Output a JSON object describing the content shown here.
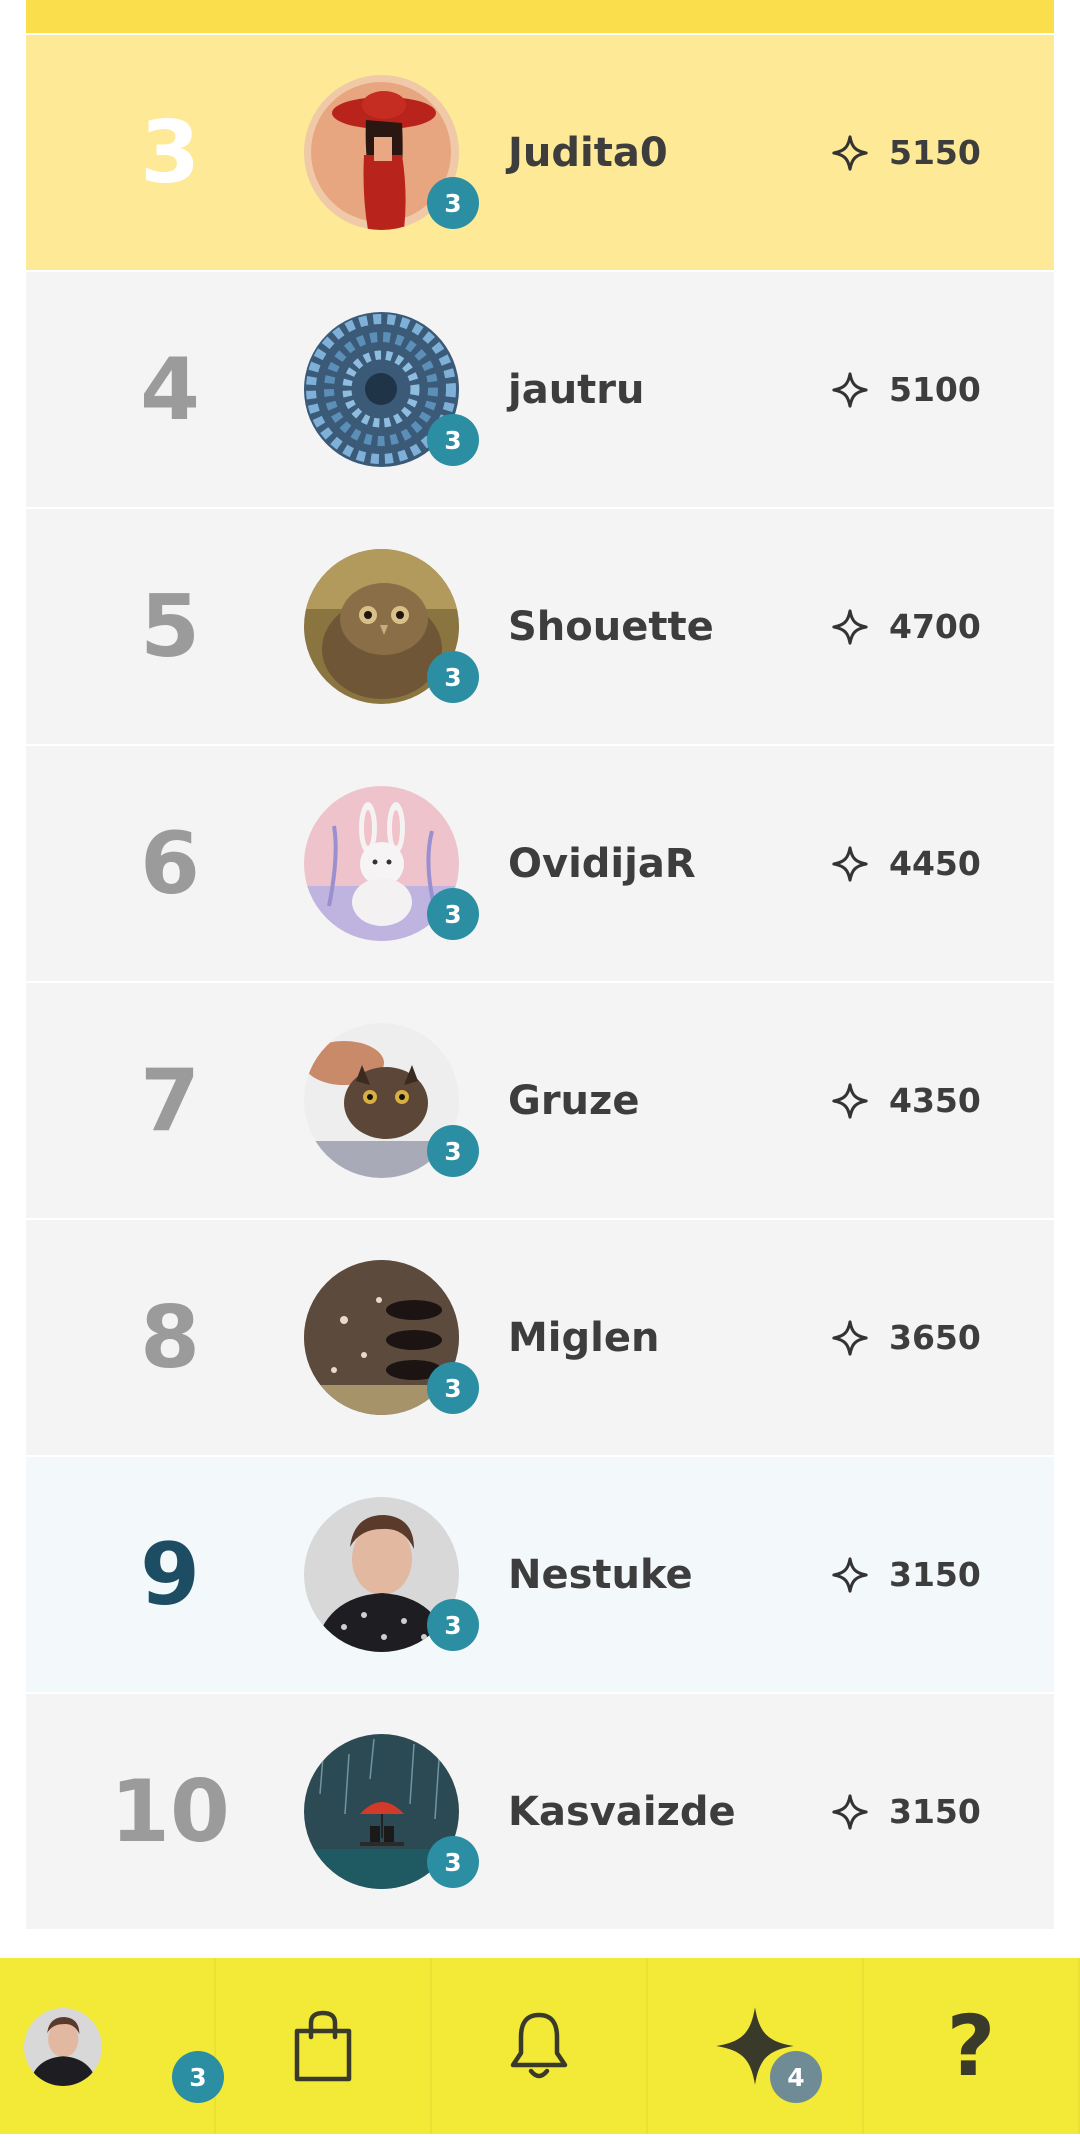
{
  "leaderboard": {
    "rows": [
      {
        "rank": "3",
        "username": "Judita0",
        "score": "5150",
        "level": "3",
        "highlight": "podium",
        "avatar": "woman-red-hat-avatar"
      },
      {
        "rank": "4",
        "username": "jautru",
        "score": "5100",
        "level": "3",
        "highlight": "none",
        "avatar": "blue-tunnel-avatar"
      },
      {
        "rank": "5",
        "username": "Shouette",
        "score": "4700",
        "level": "3",
        "highlight": "none",
        "avatar": "owl-avatar"
      },
      {
        "rank": "6",
        "username": "OvidijaR",
        "score": "4450",
        "level": "3",
        "highlight": "none",
        "avatar": "bunny-avatar"
      },
      {
        "rank": "7",
        "username": "Gruze",
        "score": "4350",
        "level": "3",
        "highlight": "none",
        "avatar": "cat-avatar"
      },
      {
        "rank": "8",
        "username": "Miglen",
        "score": "3650",
        "level": "3",
        "highlight": "none",
        "avatar": "dark-pattern-avatar"
      },
      {
        "rank": "9",
        "username": "Nestuke",
        "score": "3150",
        "level": "3",
        "highlight": "me",
        "avatar": "woman-portrait-avatar"
      },
      {
        "rank": "10",
        "username": "Kasvaizde",
        "score": "3150",
        "level": "3",
        "highlight": "none",
        "avatar": "rain-umbrella-avatar"
      }
    ]
  },
  "bottom_nav": {
    "profile_level": "3",
    "sparkles_count": "4",
    "help_label": "?"
  },
  "colors": {
    "nav_background": "#f3e937",
    "podium_row": "#fde996",
    "badge_teal": "#2b8ea3",
    "top_strip": "#fbde4b"
  }
}
